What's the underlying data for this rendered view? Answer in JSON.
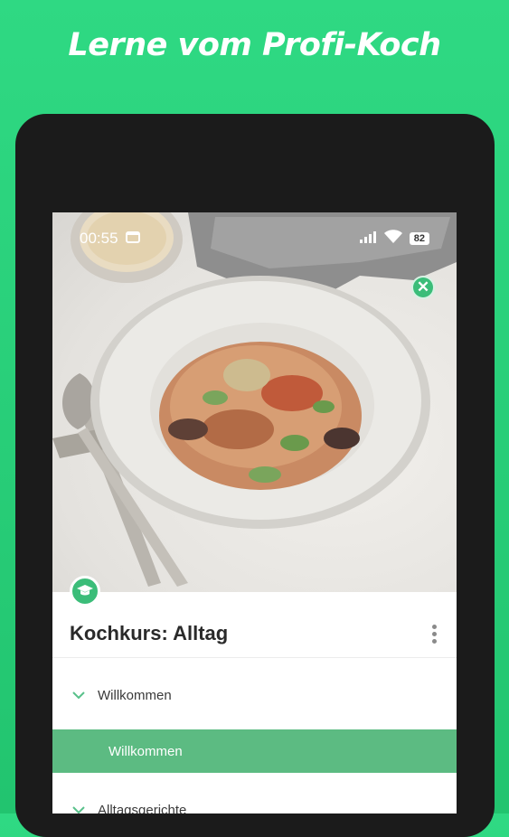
{
  "promo": {
    "headline": "Lerne vom Profi-Koch"
  },
  "status_bar": {
    "time": "00:55",
    "battery": "82"
  },
  "course": {
    "title": "Kochkurs: Alltag",
    "sections": [
      {
        "label": "Willkommen",
        "lessons": [
          {
            "label": "Willkommen",
            "selected": true
          }
        ]
      },
      {
        "label": "Alltagsgerichte"
      }
    ]
  },
  "colors": {
    "brand_green": "#2fd983",
    "accent_green": "#3bbd79",
    "selected_row": "#5cbb82"
  },
  "icons": {
    "close": "close-icon",
    "course": "graduation-cap-icon",
    "menu": "more-vertical-icon",
    "expand": "chevron-down-icon"
  }
}
